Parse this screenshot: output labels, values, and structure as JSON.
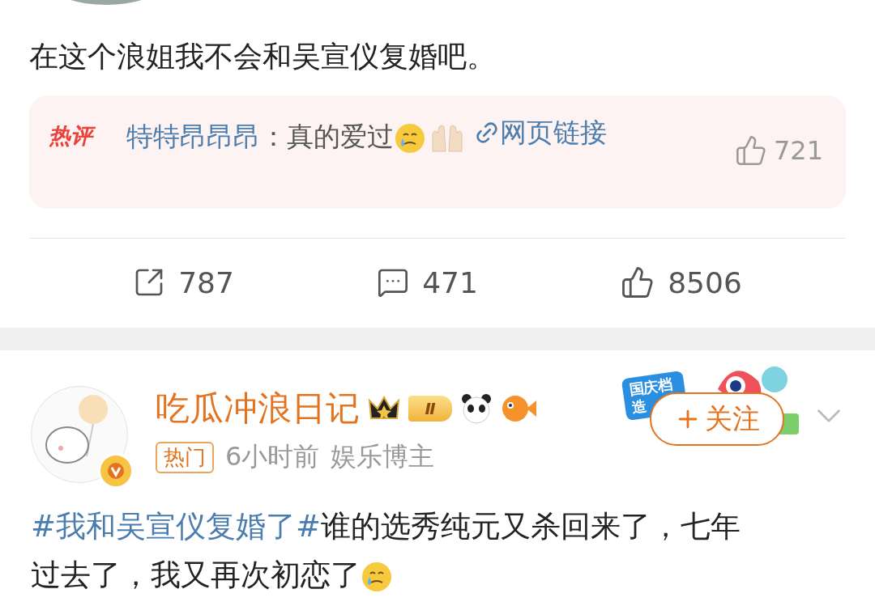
{
  "post_top": {
    "text": "在这个浪姐我不会和吴宣仪复婚吧。",
    "hot_comment": {
      "badge": "热评",
      "author": "特特昂昂昂",
      "separator": "：",
      "text": "真的爱过",
      "link": "网页链接",
      "likes": "721"
    },
    "actions": [
      {
        "kind": "share",
        "count": "787"
      },
      {
        "kind": "comment",
        "count": "471"
      },
      {
        "kind": "like",
        "count": "8506"
      }
    ]
  },
  "post": {
    "author": "吃瓜冲浪日记",
    "level_badge": "Ⅱ",
    "tag": "热门",
    "time": "6小时前",
    "role": "娱乐博主",
    "sticker": [
      "国庆档",
      "造"
    ],
    "follow_button": "关注",
    "hashtag": "#我和吴宣仪复婚了#",
    "text": "谁的选秀纯元又杀回来了，七年过去了，我又再次初恋了"
  }
}
